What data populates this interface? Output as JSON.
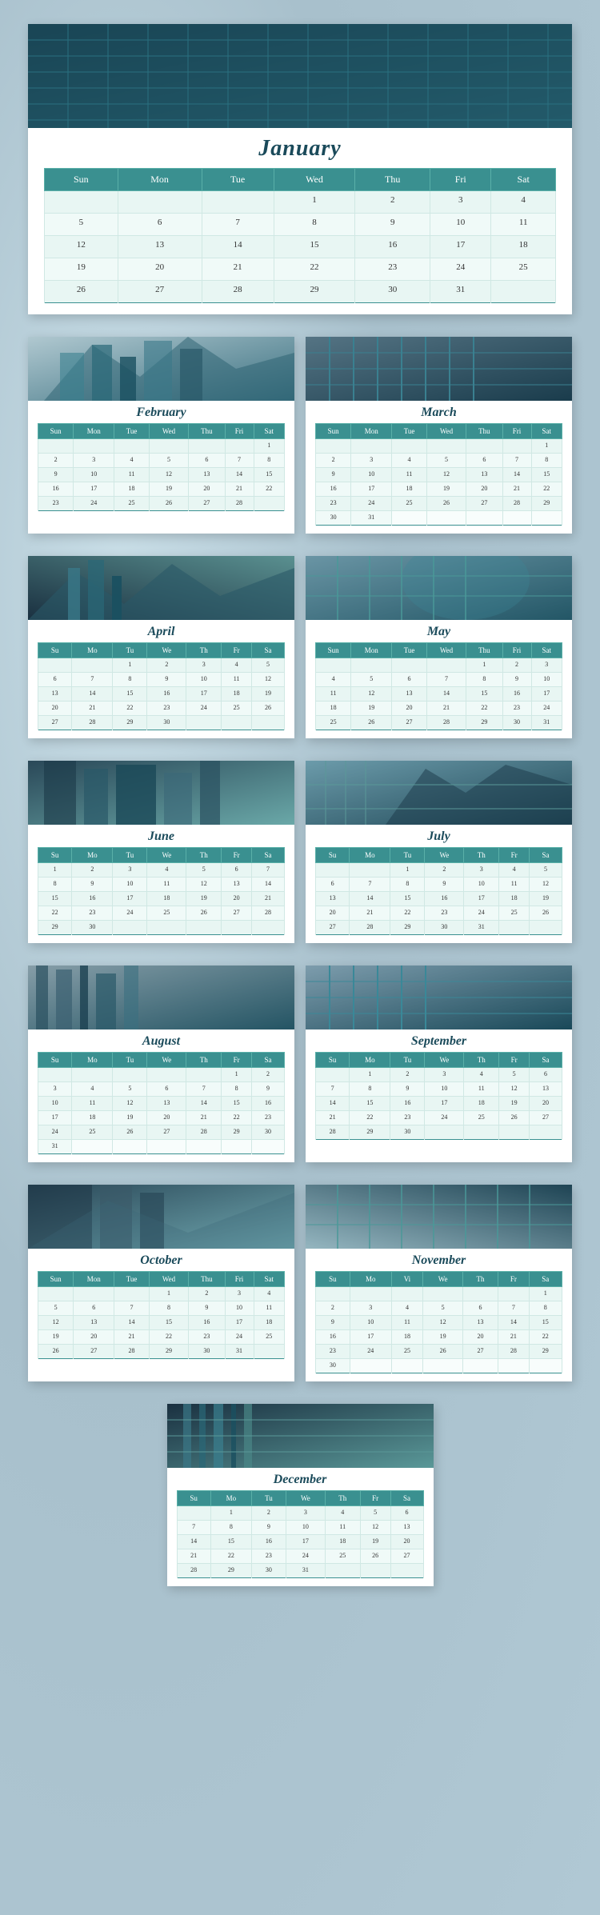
{
  "months": [
    {
      "name": "January",
      "size": "full",
      "days_header": [
        "Sun",
        "Mon",
        "Tue",
        "Wed",
        "Thu",
        "Fri",
        "Sat"
      ],
      "weeks": [
        [
          "",
          "",
          "",
          "1",
          "2",
          "3",
          "4"
        ],
        [
          "5",
          "6",
          "7",
          "8",
          "9",
          "10",
          "11"
        ],
        [
          "12",
          "13",
          "14",
          "15",
          "16",
          "17",
          "18"
        ],
        [
          "19",
          "20",
          "21",
          "22",
          "23",
          "24",
          "25"
        ],
        [
          "26",
          "27",
          "28",
          "29",
          "30",
          "31",
          ""
        ]
      ]
    },
    {
      "name": "February",
      "size": "half",
      "days_header": [
        "Sun",
        "Mon",
        "Tue",
        "Wed",
        "Thu",
        "Fri",
        "Sat"
      ],
      "weeks": [
        [
          "",
          "",
          "",
          "",
          "",
          "",
          "1"
        ],
        [
          "2",
          "3",
          "4",
          "5",
          "6",
          "7",
          "8"
        ],
        [
          "9",
          "10",
          "11",
          "12",
          "13",
          "14",
          "15"
        ],
        [
          "16",
          "17",
          "18",
          "19",
          "20",
          "21",
          "22"
        ],
        [
          "23",
          "24",
          "25",
          "26",
          "27",
          "28",
          ""
        ]
      ]
    },
    {
      "name": "March",
      "size": "half",
      "days_header": [
        "Sun",
        "Mon",
        "Tue",
        "Wed",
        "Thu",
        "Fri",
        "Sat"
      ],
      "weeks": [
        [
          "",
          "",
          "",
          "",
          "",
          "",
          "1"
        ],
        [
          "2",
          "3",
          "4",
          "5",
          "6",
          "7",
          "8"
        ],
        [
          "9",
          "10",
          "11",
          "12",
          "13",
          "14",
          "15"
        ],
        [
          "16",
          "17",
          "18",
          "19",
          "20",
          "21",
          "22"
        ],
        [
          "23",
          "24",
          "25",
          "26",
          "27",
          "28",
          "29"
        ],
        [
          "30",
          "31",
          "",
          "",
          "",
          "",
          ""
        ]
      ]
    },
    {
      "name": "April",
      "size": "half",
      "days_header": [
        "Su",
        "Mo",
        "Tu",
        "We",
        "Th",
        "Fr",
        "Sa"
      ],
      "weeks": [
        [
          "",
          "",
          "1",
          "2",
          "3",
          "4",
          "5"
        ],
        [
          "6",
          "7",
          "8",
          "9",
          "10",
          "11",
          "12"
        ],
        [
          "13",
          "14",
          "15",
          "16",
          "17",
          "18",
          "19"
        ],
        [
          "20",
          "21",
          "22",
          "23",
          "24",
          "25",
          "26"
        ],
        [
          "27",
          "28",
          "29",
          "30",
          "",
          "",
          ""
        ]
      ]
    },
    {
      "name": "May",
      "size": "half",
      "days_header": [
        "Sun",
        "Mon",
        "Tue",
        "Wed",
        "Thu",
        "Fri",
        "Sat"
      ],
      "weeks": [
        [
          "",
          "",
          "",
          "",
          "1",
          "2",
          "3"
        ],
        [
          "4",
          "5",
          "6",
          "7",
          "8",
          "9",
          "10"
        ],
        [
          "11",
          "12",
          "13",
          "14",
          "15",
          "16",
          "17"
        ],
        [
          "18",
          "19",
          "20",
          "21",
          "22",
          "23",
          "24"
        ],
        [
          "25",
          "26",
          "27",
          "28",
          "29",
          "30",
          "31"
        ]
      ]
    },
    {
      "name": "June",
      "size": "half",
      "days_header": [
        "Su",
        "Mo",
        "Tu",
        "We",
        "Th",
        "Fr",
        "Sa"
      ],
      "weeks": [
        [
          "1",
          "2",
          "3",
          "4",
          "5",
          "6",
          "7"
        ],
        [
          "8",
          "9",
          "10",
          "11",
          "12",
          "13",
          "14"
        ],
        [
          "15",
          "16",
          "17",
          "18",
          "19",
          "20",
          "21"
        ],
        [
          "22",
          "23",
          "24",
          "25",
          "26",
          "27",
          "28"
        ],
        [
          "29",
          "30",
          "",
          "",
          "",
          "",
          ""
        ]
      ]
    },
    {
      "name": "July",
      "size": "half",
      "days_header": [
        "Su",
        "Mo",
        "Tu",
        "We",
        "Th",
        "Fr",
        "Sa"
      ],
      "weeks": [
        [
          "",
          "",
          "1",
          "2",
          "3",
          "4",
          "5"
        ],
        [
          "6",
          "7",
          "8",
          "9",
          "10",
          "11",
          "12"
        ],
        [
          "13",
          "14",
          "15",
          "16",
          "17",
          "18",
          "19"
        ],
        [
          "20",
          "21",
          "22",
          "23",
          "24",
          "25",
          "26"
        ],
        [
          "27",
          "28",
          "29",
          "30",
          "31",
          "",
          ""
        ]
      ]
    },
    {
      "name": "August",
      "size": "half",
      "days_header": [
        "Su",
        "Mo",
        "Tu",
        "We",
        "Th",
        "Fr",
        "Sa"
      ],
      "weeks": [
        [
          "",
          "",
          "",
          "",
          "",
          "1",
          "2"
        ],
        [
          "3",
          "4",
          "5",
          "6",
          "7",
          "8",
          "9"
        ],
        [
          "10",
          "11",
          "12",
          "13",
          "14",
          "15",
          "16"
        ],
        [
          "17",
          "18",
          "19",
          "20",
          "21",
          "22",
          "23"
        ],
        [
          "24",
          "25",
          "26",
          "27",
          "28",
          "29",
          "30"
        ],
        [
          "31",
          "",
          "",
          "",
          "",
          "",
          ""
        ]
      ]
    },
    {
      "name": "September",
      "size": "half",
      "days_header": [
        "Su",
        "Mo",
        "Tu",
        "We",
        "Th",
        "Fr",
        "Sa"
      ],
      "weeks": [
        [
          "",
          "1",
          "2",
          "3",
          "4",
          "5",
          "6"
        ],
        [
          "7",
          "8",
          "9",
          "10",
          "11",
          "12",
          "13"
        ],
        [
          "14",
          "15",
          "16",
          "17",
          "18",
          "19",
          "20"
        ],
        [
          "21",
          "22",
          "23",
          "24",
          "25",
          "26",
          "27"
        ],
        [
          "28",
          "29",
          "30",
          "",
          "",
          "",
          ""
        ]
      ]
    },
    {
      "name": "October",
      "size": "half",
      "days_header": [
        "Sun",
        "Mon",
        "Tue",
        "Wed",
        "Thu",
        "Fri",
        "Sat"
      ],
      "weeks": [
        [
          "",
          "",
          "",
          "1",
          "2",
          "3",
          "4"
        ],
        [
          "5",
          "6",
          "7",
          "8",
          "9",
          "10",
          "11"
        ],
        [
          "12",
          "13",
          "14",
          "15",
          "16",
          "17",
          "18"
        ],
        [
          "19",
          "20",
          "21",
          "22",
          "23",
          "24",
          "25"
        ],
        [
          "26",
          "27",
          "28",
          "29",
          "30",
          "31",
          ""
        ]
      ]
    },
    {
      "name": "November",
      "size": "half",
      "days_header": [
        "Su",
        "Mo",
        "Vi",
        "We",
        "Th",
        "Fr",
        "Sa"
      ],
      "weeks": [
        [
          "",
          "",
          "",
          "",
          "",
          "",
          "1"
        ],
        [
          "2",
          "3",
          "4",
          "5",
          "6",
          "7",
          "8"
        ],
        [
          "9",
          "10",
          "11",
          "12",
          "13",
          "14",
          "15"
        ],
        [
          "16",
          "17",
          "18",
          "19",
          "20",
          "21",
          "22"
        ],
        [
          "23",
          "24",
          "25",
          "26",
          "27",
          "28",
          "29"
        ],
        [
          "30",
          "",
          "",
          "",
          "",
          "",
          ""
        ]
      ]
    },
    {
      "name": "December",
      "size": "single",
      "days_header": [
        "Su",
        "Mo",
        "Tu",
        "We",
        "Th",
        "Fr",
        "Sa"
      ],
      "weeks": [
        [
          "",
          "1",
          "2",
          "3",
          "4",
          "5",
          "6"
        ],
        [
          "7",
          "8",
          "9",
          "10",
          "11",
          "12",
          "13"
        ],
        [
          "14",
          "15",
          "16",
          "17",
          "18",
          "19",
          "20"
        ],
        [
          "21",
          "22",
          "23",
          "24",
          "25",
          "26",
          "27"
        ],
        [
          "28",
          "29",
          "30",
          "31",
          "",
          "",
          ""
        ]
      ]
    }
  ]
}
